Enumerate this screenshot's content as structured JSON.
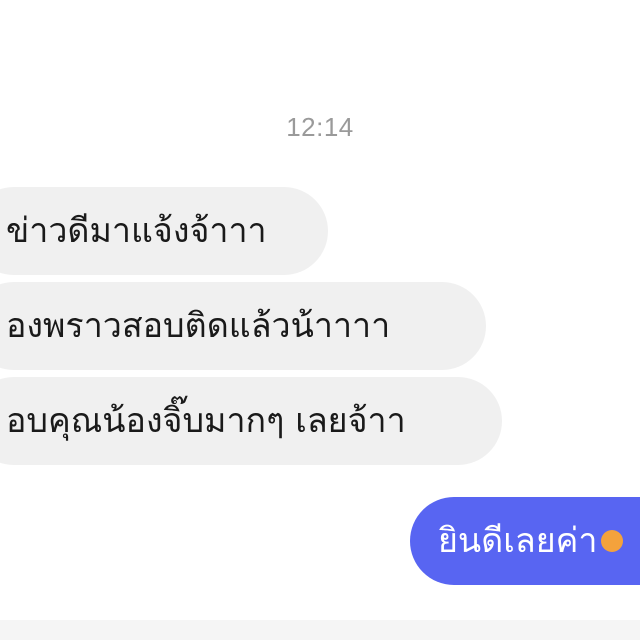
{
  "chat": {
    "timestamp": "12:14",
    "incoming": [
      "ข่าวดีมาแจ้งจ้าาา",
      "องพราวสอบติดแล้วน้าาาา",
      "อบคุณน้องจิ๊บมากๆ เลยจ้าา"
    ],
    "outgoing": [
      "ยินดีเลยค่า"
    ],
    "colors": {
      "incoming_bg": "#f0f0f0",
      "outgoing_bg": "#5865f2",
      "timestamp": "#9a9a9a"
    }
  }
}
